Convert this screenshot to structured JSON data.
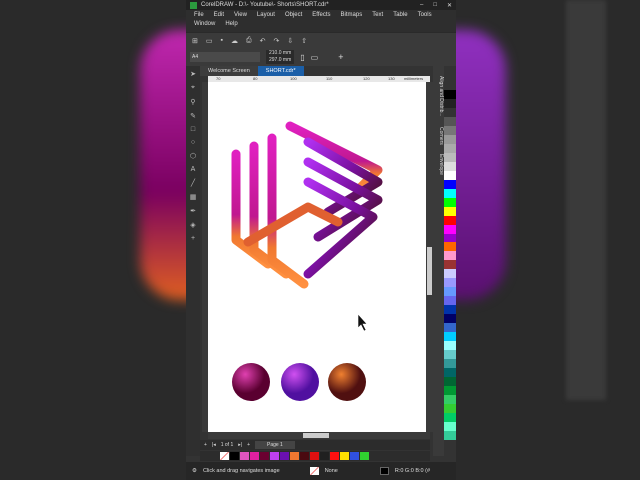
{
  "title": "CorelDRAW - D:\\- Youtube\\- Shorts\\SHORT.cdr*",
  "menu": [
    "File",
    "Edit",
    "View",
    "Layout",
    "Object",
    "Effects",
    "Bitmaps",
    "Text",
    "Table",
    "Tools",
    "Window",
    "Help"
  ],
  "page_size": "A4",
  "width": "210.0 mm",
  "height": "297.0 mm",
  "tabs": [
    "Welcome Screen",
    "SHORT.cdr*"
  ],
  "ruler": {
    "ticks": [
      "70",
      "80",
      "100",
      "110",
      "120",
      "130"
    ],
    "unit": "millimeters"
  },
  "page_nav": {
    "current": "1 of 1",
    "page_tab": "Page 1"
  },
  "dockers": [
    "Align and Distrib...",
    "Corners",
    "Envelope"
  ],
  "doc_palette": [
    "#000000",
    "#e055c0",
    "#e020a0",
    "#6a0030",
    "#c040f0",
    "#6a10b0",
    "#f07830",
    "#4a0a10",
    "#e01010",
    "#202020",
    "#ff1010",
    "#ffe000",
    "#3050e0",
    "#30d030"
  ],
  "palette": [
    "#000000",
    "#222222",
    "#333333",
    "#555555",
    "#777777",
    "#999999",
    "#aaaaaa",
    "#bbbbbb",
    "#dddddd",
    "#ffffff",
    "#0000ff",
    "#00ffff",
    "#00ff00",
    "#ffff00",
    "#ff0000",
    "#ff00ff",
    "#9900cc",
    "#ff6600",
    "#ff99cc",
    "#993333",
    "#ccccff",
    "#9999ff",
    "#6699ff",
    "#6666ee",
    "#0033aa",
    "#000066",
    "#3366cc",
    "#00ccff",
    "#99ffff",
    "#66cccc",
    "#339999",
    "#006666",
    "#006633",
    "#009933",
    "#33cc66",
    "#33cc33",
    "#00cc66",
    "#66ffcc",
    "#33cc99"
  ],
  "status": {
    "hint": "Click and drag navigates image",
    "fill": "None",
    "color": "R:0 G:0 B:0 (#"
  }
}
